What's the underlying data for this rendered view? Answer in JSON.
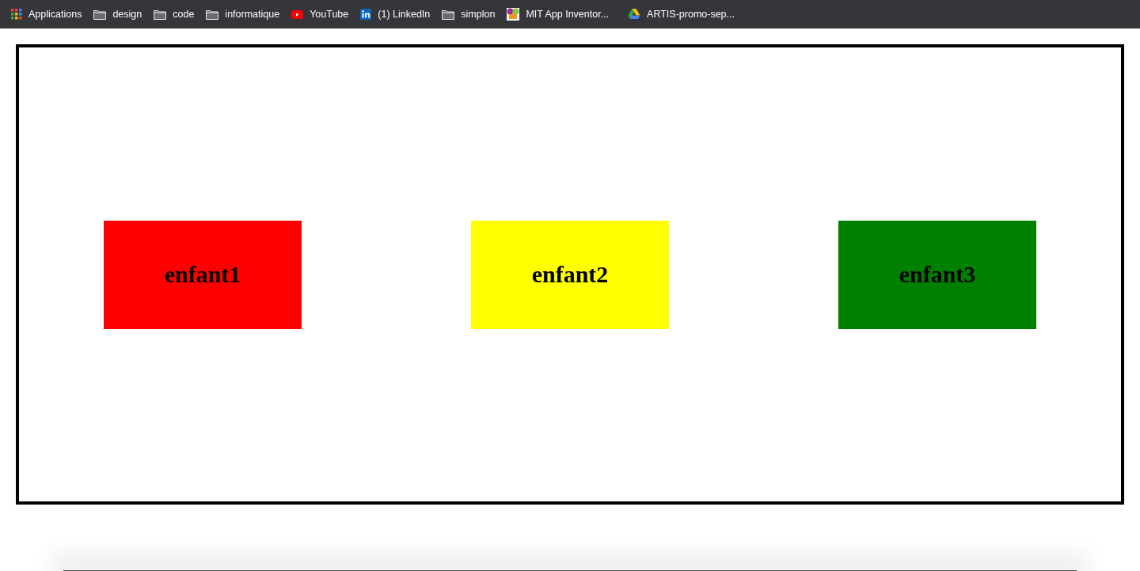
{
  "bookmarks_bar": [
    {
      "kind": "apps",
      "label": "Applications"
    },
    {
      "kind": "folder",
      "label": "design"
    },
    {
      "kind": "folder",
      "label": "code"
    },
    {
      "kind": "folder",
      "label": "informatique"
    },
    {
      "kind": "youtube",
      "label": "YouTube"
    },
    {
      "kind": "linkedin",
      "label": "(1) LinkedIn"
    },
    {
      "kind": "folder",
      "label": "simplon"
    },
    {
      "kind": "mit",
      "label": "MIT App Inventor..."
    },
    {
      "kind": "drive",
      "label": "ARTIS-promo-sep..."
    }
  ],
  "container": {
    "children": [
      {
        "label": "enfant1",
        "color": "#ff0000"
      },
      {
        "label": "enfant2",
        "color": "#ffff00"
      },
      {
        "label": "enfant3",
        "color": "#008000"
      }
    ]
  }
}
